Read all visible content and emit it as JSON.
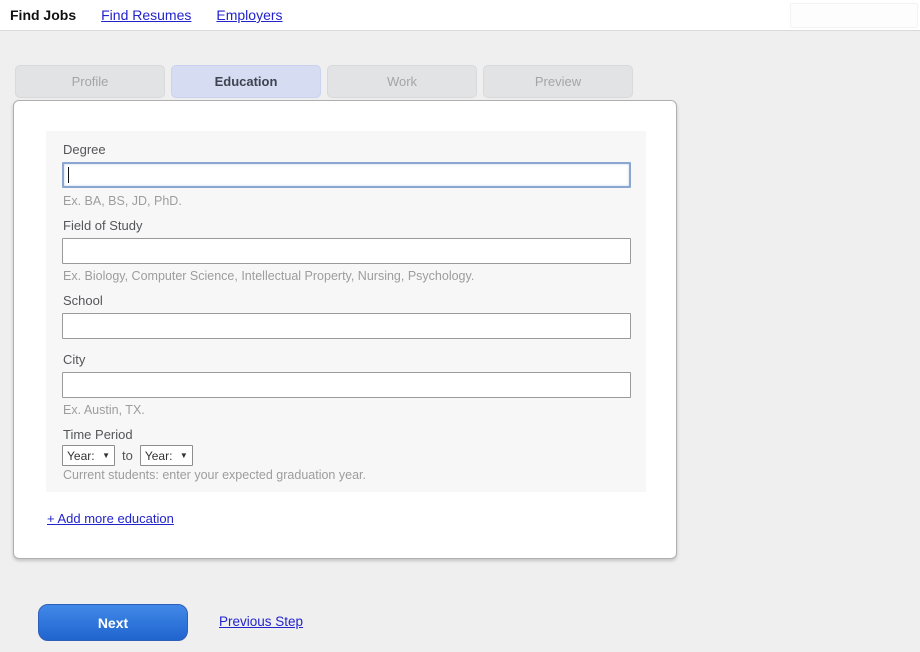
{
  "topnav": {
    "items": [
      {
        "label": "Find Jobs",
        "active": true
      },
      {
        "label": "Find Resumes",
        "active": false
      },
      {
        "label": "Employers",
        "active": false
      }
    ]
  },
  "steps": {
    "tabs": [
      {
        "label": "Profile",
        "active": false
      },
      {
        "label": "Education",
        "active": true
      },
      {
        "label": "Work",
        "active": false
      },
      {
        "label": "Preview",
        "active": false
      }
    ]
  },
  "form": {
    "degree": {
      "label": "Degree",
      "value": "",
      "hint": "Ex. BA, BS, JD, PhD.",
      "focused": true
    },
    "field_of_study": {
      "label": "Field of Study",
      "value": "",
      "hint": "Ex. Biology, Computer Science, Intellectual Property, Nursing, Psychology."
    },
    "school": {
      "label": "School",
      "value": ""
    },
    "city": {
      "label": "City",
      "value": "",
      "hint": "Ex. Austin, TX."
    },
    "time_period": {
      "label": "Time Period",
      "from_selected": "Year:",
      "connector": "to",
      "to_selected": "Year:",
      "hint": "Current students: enter your expected graduation year."
    },
    "add_more_label": "+ Add more education"
  },
  "actions": {
    "next_label": "Next",
    "previous_label": "Previous Step"
  },
  "colors": {
    "link": "#2323cc",
    "accent_button": "#2b72dd",
    "active_tab_bg": "#d6ddf3",
    "page_bg": "#efefef",
    "focused_input_border": "#8aa6d1"
  }
}
